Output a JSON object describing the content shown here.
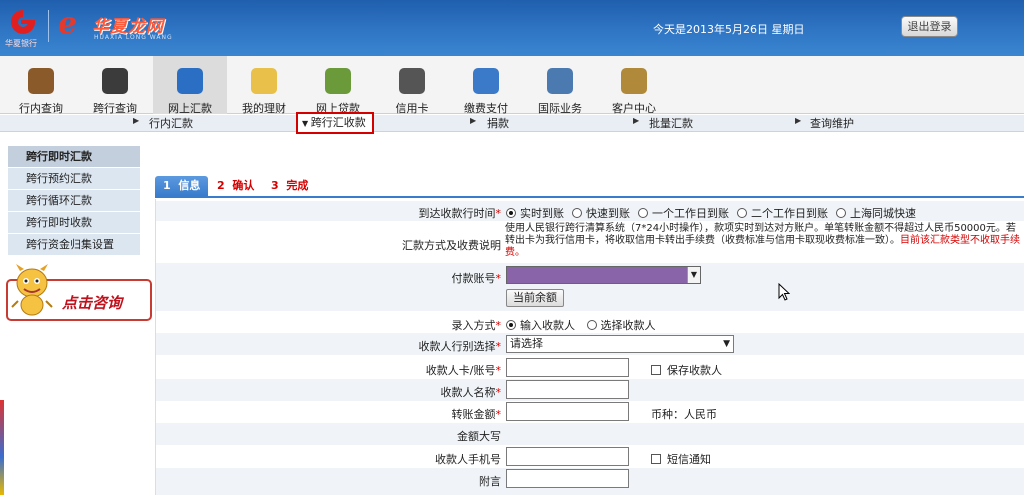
{
  "header": {
    "bank_name": "华夏银行",
    "brand_logo_letter": "e",
    "brand_text": "华夏龙网",
    "brand_sub": "HUAXIA LONG WANG",
    "date_text": "今天是2013年5月26日 星期日",
    "logout_label": "退出登录"
  },
  "menu": [
    {
      "label": "行内查询",
      "icon": "book-icon",
      "color": "#8a5a2a"
    },
    {
      "label": "跨行查询",
      "icon": "grid-icon",
      "color": "#3b3b3b"
    },
    {
      "label": "网上汇款",
      "icon": "ie-icon",
      "color": "#2a6fc4"
    },
    {
      "label": "我的理财",
      "icon": "chart-icon",
      "color": "#e8c04a"
    },
    {
      "label": "网上贷款",
      "icon": "money-bag-icon",
      "color": "#6a9a3a"
    },
    {
      "label": "信用卡",
      "icon": "credit-card-icon",
      "color": "#555555"
    },
    {
      "label": "缴费支付",
      "icon": "house-icon",
      "color": "#3a7ac8"
    },
    {
      "label": "国际业务",
      "icon": "globe-icon",
      "color": "#4a7ab0"
    },
    {
      "label": "客户中心",
      "icon": "person-icon",
      "color": "#b08a3a"
    }
  ],
  "submenu": [
    {
      "label": "行内汇款"
    },
    {
      "label": "跨行汇收款"
    },
    {
      "label": "捐款"
    },
    {
      "label": "批量汇款"
    },
    {
      "label": "查询维护"
    }
  ],
  "sidebar": [
    {
      "label": "跨行即时汇款"
    },
    {
      "label": "跨行预约汇款"
    },
    {
      "label": "跨行循环汇款"
    },
    {
      "label": "跨行即时收款"
    },
    {
      "label": "跨行资金归集设置"
    }
  ],
  "consult_label": "点击咨询",
  "steps": [
    {
      "num": "1",
      "label": "信息"
    },
    {
      "num": "2",
      "label": "确认"
    },
    {
      "num": "3",
      "label": "完成"
    }
  ],
  "form": {
    "arrival_label": "到达收款行时间",
    "arrival_options": [
      "实时到账",
      "快速到账",
      "一个工作日到账",
      "二个工作日到账",
      "上海同城快速"
    ],
    "method_label": "汇款方式及收费说明",
    "method_desc": "使用人民银行跨行清算系统（7*24小时操作），款项实时到达对方账户。单笔转账金额不得超过人民币50000元。若转出卡为我行信用卡，将收取信用卡转出手续费（收费标准与信用卡取现收费标准一致）。",
    "method_desc_red": "目前该汇款类型不收取手续费。",
    "pay_account_label": "付款账号",
    "balance_button": "当前余额",
    "entry_label": "录入方式",
    "entry_options": [
      "输入收款人",
      "选择收款人"
    ],
    "bank_select_label": "收款人行别选择",
    "bank_select_value": "请选择",
    "card_label": "收款人卡/账号",
    "save_payee": "保存收款人",
    "name_label": "收款人名称",
    "amount_label": "转账金额",
    "currency": "币种：人民币",
    "amount_upper_label": "金额大写",
    "phone_label": "收款人手机号",
    "sms_notice": "短信通知",
    "memo_label": "附言"
  }
}
